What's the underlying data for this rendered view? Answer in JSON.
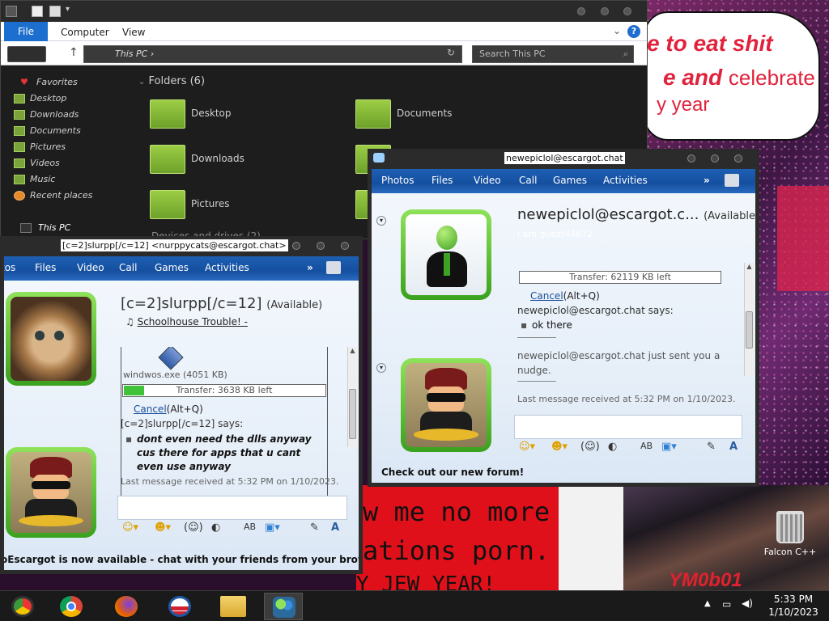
{
  "wallpaper": {
    "bubble_line1": "e to eat shit",
    "bubble_line2": "e and",
    "bubble_line2b": "celebrate",
    "bubble_line3": "y year",
    "banner_line1": "w me no more",
    "banner_line2": "ations porn.",
    "banner_line3": "Y JEW YEAR!",
    "crowd_text": "YM0b01"
  },
  "desktop": {
    "recycle_label": "Falcon C++"
  },
  "explorer": {
    "ribbon": {
      "file": "File",
      "computer": "Computer",
      "view": "View",
      "help": "?"
    },
    "address": {
      "path": "This PC",
      "search_placeholder": "Search This PC"
    },
    "nav": {
      "favorites": "Favorites",
      "items": [
        "Desktop",
        "Downloads",
        "Documents",
        "Pictures",
        "Videos",
        "Music",
        "Recent places"
      ],
      "this_pc": "This PC"
    },
    "folders_header": "Folders (6)",
    "folders": [
      "Desktop",
      "Documents",
      "Downloads",
      "Pictures"
    ],
    "devices_header": "Devices and drives (2)"
  },
  "chat_left": {
    "title": "[c=2]slurpp[/c=12] <nurppycats@escargot.chat>",
    "toolbar": [
      "tos",
      "Files",
      "Video",
      "Call",
      "Games",
      "Activities"
    ],
    "toolbar_more": "»",
    "contact_name": "[c=2]slurpp[/c=12]",
    "contact_status": "(Available)",
    "now_playing": "Schoolhouse Trouble! -",
    "file_name": "windwos.exe (4051 KB)",
    "transfer_text": "Transfer: 3638 KB left",
    "transfer_progress": 0.1,
    "cancel": "Cancel",
    "cancel_hint": "(Alt+Q)",
    "says": "[c=2]slurpp[/c=12] says:",
    "message": "dont even need the dlls anyway cus there for apps that u cant even use anyway",
    "last_msg": "Last message received at 5:32 PM on 1/10/2023.",
    "footer": "oEscargot is now available - chat with your friends from your browser"
  },
  "chat_right": {
    "title": "newepiclol@escargot.chat",
    "toolbar": [
      "Photos",
      "Files",
      "Video",
      "Call",
      "Games",
      "Activities"
    ],
    "toolbar_more": "»",
    "contact_name": "newepiclol@escargot.c...",
    "contact_status": "(Available)",
    "personal_msg": "i am guest44672",
    "transfer_text": "Transfer: 62119 KB left",
    "cancel": "Cancel",
    "cancel_hint": "(Alt+Q)",
    "says": "newepiclol@escargot.chat says:",
    "message": "ok there",
    "nudge": "newepiclol@escargot.chat just sent you a nudge.",
    "last_msg": "Last message received at 5:32 PM on 1/10/2023.",
    "footer": "Check out our new forum!"
  },
  "taskbar": {
    "icons": [
      "chrome-canary-icon",
      "chrome-icon",
      "firefox-icon",
      "obama-logo-icon",
      "file-explorer-icon",
      "messenger-icon"
    ],
    "time": "5:33 PM",
    "date": "1/10/2023"
  },
  "colors": {
    "accent": "#1c6ecf",
    "msn_toolbar": "#1d5fb3",
    "avatar_frame": "#5cc32e",
    "explorer_bg": "#1d1d1d"
  }
}
